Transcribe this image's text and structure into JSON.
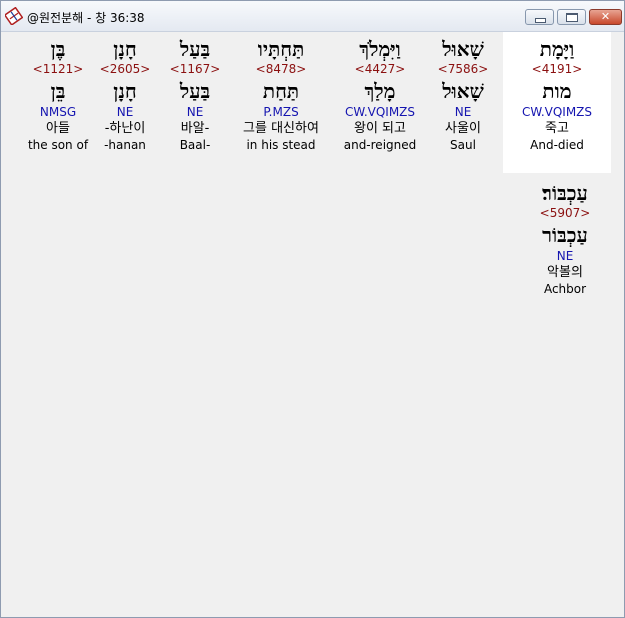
{
  "window": {
    "title": "@원전분해 - 창 36:38"
  },
  "icons": {
    "app": "bible-app-icon",
    "minimize": "minimize-icon",
    "maximize": "maximize-icon",
    "close": "close-icon"
  },
  "words": [
    {
      "hebrew": "וַיָּמָת",
      "strong": "<4191>",
      "root": "מות",
      "parsing": "CW.VQIMZS",
      "korean": "죽고",
      "english": "And-died"
    },
    {
      "hebrew": "שָׁאוּל",
      "strong": "<7586>",
      "root": "שָׁאוּל",
      "parsing": "NE",
      "korean": "사울이",
      "english": "Saul"
    },
    {
      "hebrew": "וַיִּמְלֹךְ",
      "strong": "<4427>",
      "root": "מָלַךְ",
      "parsing": "CW.VQIMZS",
      "korean": "왕이 되고",
      "english": "and-reigned"
    },
    {
      "hebrew": "תַּחְתָּיו",
      "strong": "<8478>",
      "root": "תַּחַת",
      "parsing": "P.MZS",
      "korean": "그를 대신하여",
      "english": "in his stead"
    },
    {
      "hebrew": "בַּעַל",
      "strong": "<1167>",
      "root": "בַּעַל",
      "parsing": "NE",
      "korean": "바알-",
      "english": "Baal-"
    },
    {
      "hebrew": "חָנָן",
      "strong": "<2605>",
      "root": "חָנָן",
      "parsing": "NE",
      "korean": "-하난이",
      "english": "-hanan"
    },
    {
      "hebrew": "בֶּן",
      "strong": "<1121>",
      "root": "בֵּן",
      "parsing": "NMSG",
      "korean": "아들",
      "english": "the son of"
    },
    {
      "hebrew": "עַכְבּוֹר׃",
      "strong": "<5907>",
      "root": "עַכְבּוֹר",
      "parsing": "NE",
      "korean": "악볼의",
      "english": "Achbor"
    }
  ]
}
